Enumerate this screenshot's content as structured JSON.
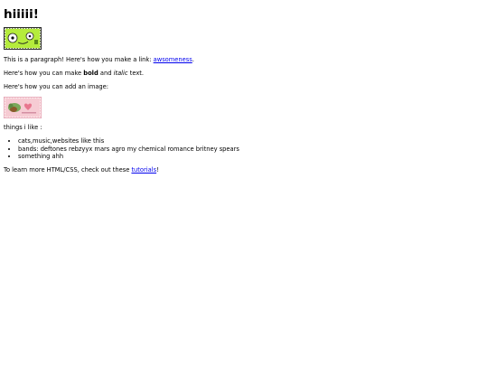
{
  "page": {
    "heading": "hiiiii!",
    "para_link_prefix": "This is a paragraph! Here's how you make a link: ",
    "para_link_text": "awsomeness",
    "para_link_suffix": ".",
    "bold_prefix": "Here's how you can make ",
    "bold_text": "bold",
    "bold_middle": " and ",
    "italic_text": "italic",
    "bold_suffix": " text.",
    "image_intro": "Here's how you can add an image:",
    "likes_heading": "things i like :",
    "likes": [
      "cats,music,websites like this",
      "bands: deftones rebzyyx mars agro my chemical romance britney spears",
      "something ahh"
    ],
    "tutorial_prefix": "To learn more HTML/CSS, check out these ",
    "tutorial_link_text": "tutorials",
    "tutorial_suffix": "!"
  },
  "images": {
    "banner_icon": "green-cartoon-face-stamp",
    "cat_icon": "cat-pink-heart-stamp"
  }
}
